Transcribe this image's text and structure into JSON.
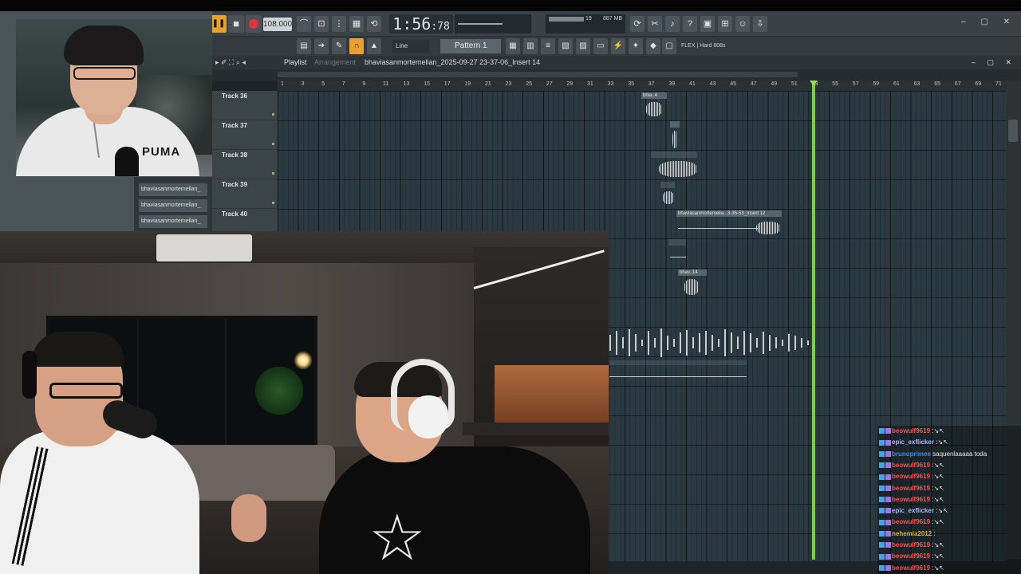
{
  "toolbar": {
    "tempo": "108.000",
    "time_main": "1:56",
    "time_sub": "78",
    "memory_value": "19",
    "memory_mb": "887 MB",
    "memory_poly": "1",
    "line_mode": "Line",
    "pattern": "Pattern 1",
    "plugin": "FLEX | Hard 808s"
  },
  "playlist": {
    "title": "Playlist",
    "subtitle": "Arrangement",
    "file": "bhaviasanmortemelian_2025-09-27 23-37-06_Insert 14",
    "ruler_numbers": [
      "1",
      "3",
      "5",
      "7",
      "9",
      "11",
      "13",
      "15",
      "17",
      "19",
      "21",
      "23",
      "25",
      "27",
      "29",
      "31",
      "33",
      "35",
      "37",
      "39",
      "41",
      "43",
      "45",
      "47",
      "49",
      "51",
      "53",
      "55",
      "57",
      "59",
      "61",
      "63",
      "65",
      "67",
      "69",
      "71"
    ],
    "tracks": [
      {
        "label": "Track 36"
      },
      {
        "label": "Track 37"
      },
      {
        "label": "Track 38"
      },
      {
        "label": "Track 39"
      },
      {
        "label": "Track 40"
      }
    ],
    "clips": {
      "c1": "bhia..4",
      "c2": "bhaviasanmortemelia...3-35-53_Insert 12",
      "c3": "bhav..14"
    }
  },
  "browser": {
    "items": [
      "bhaviasanmortemelian_",
      "bhaviasanmortemelian_",
      "bhaviasanmortemelian_"
    ]
  },
  "webcam": {
    "shirt_logo": "PUMA"
  },
  "chat": {
    "messages": [
      {
        "user": "beowulf9619",
        "msg": ":↘↖",
        "color": "#ff4f4f"
      },
      {
        "user": "epic_exflicker",
        "msg": ":↘↖",
        "color": "#a9b4ff"
      },
      {
        "user": "brunoprimee",
        "msg": "saquenlaaaaa toda",
        "color": "#3d8de0"
      },
      {
        "user": "beowulf9619",
        "msg": ":↘↖",
        "color": "#ff4f4f"
      },
      {
        "user": "beowulf9619",
        "msg": ":↘↖",
        "color": "#ff4f4f"
      },
      {
        "user": "beowulf9619",
        "msg": ":↘↖",
        "color": "#ff4f4f"
      },
      {
        "user": "beowulf9619",
        "msg": ":↘↖",
        "color": "#ff4f4f"
      },
      {
        "user": "epic_exflicker",
        "msg": ":↘↖",
        "color": "#a9b4ff"
      },
      {
        "user": "beowulf9619",
        "msg": ":↘↖",
        "color": "#ff4f4f"
      },
      {
        "user": "nehemia2012",
        "msg": ":",
        "color": "#d6b53a"
      },
      {
        "user": "beowulf9619",
        "msg": ":↘↖",
        "color": "#ff4f4f"
      },
      {
        "user": "beowulf9619",
        "msg": ":↘↖",
        "color": "#ff4f4f"
      },
      {
        "user": "beowulf9619",
        "msg": ":↘↖",
        "color": "#ff4f4f"
      }
    ]
  },
  "colors": {
    "playhead": "#79d23d",
    "grid": "#2b3a41",
    "accent": "#e8a033"
  }
}
